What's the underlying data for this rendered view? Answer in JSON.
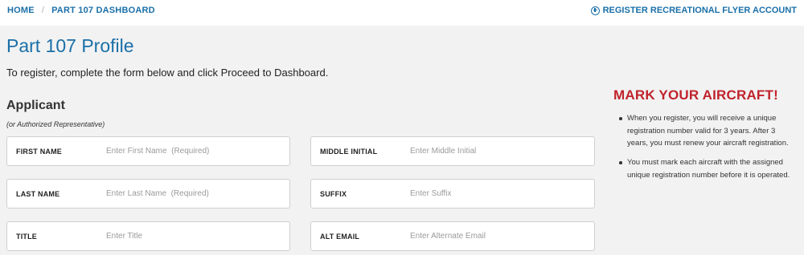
{
  "breadcrumb": {
    "home": "HOME",
    "separator": "/",
    "current": "PART 107 DASHBOARD"
  },
  "header": {
    "register_link": "REGISTER RECREATIONAL FLYER ACCOUNT",
    "register_icon": "plus-circle-icon"
  },
  "page": {
    "title": "Part 107 Profile",
    "intro": "To register, complete the form below and click Proceed to Dashboard."
  },
  "applicant": {
    "title": "Applicant",
    "subtitle": "(or Authorized Representative)",
    "fields": {
      "first_name": {
        "label": "FIRST NAME",
        "placeholder": "Enter First Name  (Required)",
        "value": ""
      },
      "middle_initial": {
        "label": "MIDDLE INITIAL",
        "placeholder": "Enter Middle Initial",
        "value": ""
      },
      "last_name": {
        "label": "LAST NAME",
        "placeholder": "Enter Last Name  (Required)",
        "value": ""
      },
      "suffix": {
        "label": "SUFFIX",
        "placeholder": "Enter Suffix",
        "value": ""
      },
      "title": {
        "label": "TITLE",
        "placeholder": "Enter Title",
        "value": ""
      },
      "alt_email": {
        "label": "ALT EMAIL",
        "placeholder": "Enter Alternate Email",
        "value": ""
      }
    }
  },
  "sidebar": {
    "title": "MARK YOUR AIRCRAFT!",
    "bullets": [
      "When you register, you will receive a unique registration number valid for 3 years. After 3 years, you must renew your aircraft registration.",
      "You must mark each aircraft with the assigned unique registration number before it is operated."
    ]
  },
  "colors": {
    "link_blue": "#1a6fa8",
    "alert_red": "#c0232c",
    "background": "#f2f2f2"
  }
}
